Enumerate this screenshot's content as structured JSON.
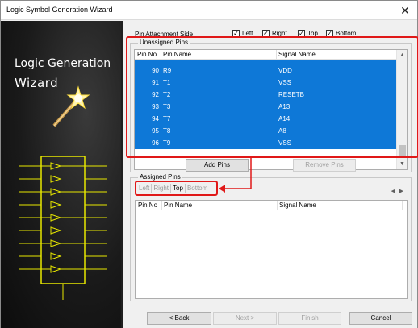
{
  "window": {
    "title": "Logic Symbol Generation Wizard",
    "close_glyph": "✕"
  },
  "banner": {
    "line1": "Logic Generation",
    "line2": "Wizard"
  },
  "pin_side": {
    "label": "Pin Attachment Side",
    "options": [
      {
        "label": "Left",
        "checked": true
      },
      {
        "label": "Right",
        "checked": true
      },
      {
        "label": "Top",
        "checked": true
      },
      {
        "label": "Bottom",
        "checked": true
      }
    ]
  },
  "unassigned": {
    "label": "Unassigned Pins",
    "columns": [
      "Pin No",
      "Pin Name",
      "Signal Name"
    ],
    "rows": [
      {
        "pin_no": "90",
        "pin_name": "R9",
        "signal": "VDD"
      },
      {
        "pin_no": "91",
        "pin_name": "T1",
        "signal": "VSS"
      },
      {
        "pin_no": "92",
        "pin_name": "T2",
        "signal": "RESETB"
      },
      {
        "pin_no": "93",
        "pin_name": "T3",
        "signal": "A13"
      },
      {
        "pin_no": "94",
        "pin_name": "T7",
        "signal": "A14"
      },
      {
        "pin_no": "95",
        "pin_name": "T8",
        "signal": "A8"
      },
      {
        "pin_no": "96",
        "pin_name": "T9",
        "signal": "VSS"
      }
    ]
  },
  "buttons": {
    "add_pins": "Add Pins",
    "remove_pins": "Remove Pins"
  },
  "assigned": {
    "label": "Assigned Pins",
    "tabs": [
      "Left",
      "Right",
      "Top",
      "Bottom"
    ],
    "active_tab": "Top",
    "columns": [
      "Pin No",
      "Pin Name",
      "Signal Name"
    ],
    "nav_left": "◀",
    "nav_right": "▶"
  },
  "footer": {
    "back": "< Back",
    "next": "Next >",
    "finish": "Finish",
    "cancel": "Cancel"
  },
  "colors": {
    "selection": "#0e78d7",
    "highlight": "#e01818",
    "banner_accent": "#e8e800"
  }
}
